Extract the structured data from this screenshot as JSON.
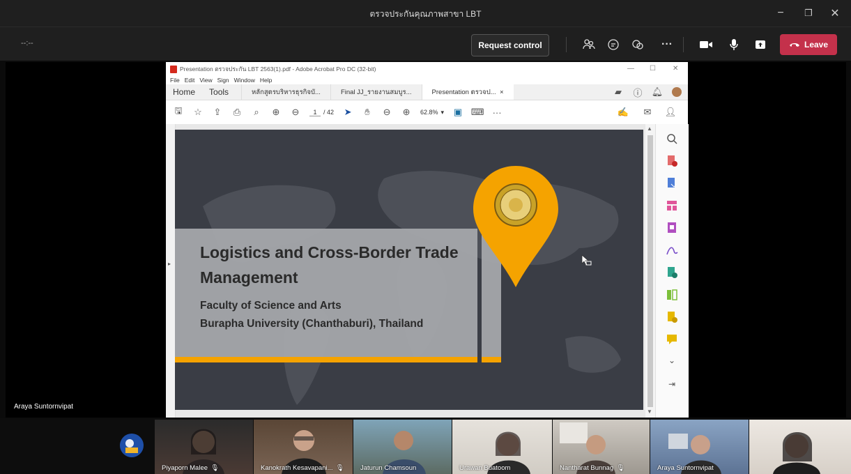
{
  "window": {
    "title": "ตรวจประกันคุณภาพสาขา LBT",
    "minimize": "−",
    "maximize": "❐",
    "close": "✕"
  },
  "meeting": {
    "timer": "--:--",
    "request_control": "Request control",
    "leave_label": "Leave",
    "leave_color": "#c4314b"
  },
  "presenter": {
    "name": "Araya Suntornvipat"
  },
  "acrobat": {
    "title": "Presentation ตรวจประกัน LBT 2563(1).pdf - Adobe Acrobat Pro DC (32-bit)",
    "menu": [
      "File",
      "Edit",
      "View",
      "Sign",
      "Window",
      "Help"
    ],
    "nav": [
      "Home",
      "Tools"
    ],
    "tabs": [
      {
        "label": "หลักสูตรบริหารธุรกิจบั..."
      },
      {
        "label": "Final JJ_รายงานสมบูร..."
      },
      {
        "label": "Presentation ตรวจป...",
        "close": "×"
      }
    ],
    "page_current": "1",
    "page_total": "/ 42",
    "zoom": "62.8%",
    "more": "···"
  },
  "slide": {
    "title_line1": "Logistics and Cross-Border Trade",
    "title_line2": "Management",
    "sub_line1": "Faculty of Science and Arts",
    "sub_line2": "Burapha University (Chanthaburi), Thailand",
    "accent_color": "#f5a300",
    "bg_color": "#3a3d45"
  },
  "participants": [
    {
      "name": "Piyaporn Malee",
      "muted": true
    },
    {
      "name": "Kanokrath Kesavapani...",
      "muted": true
    },
    {
      "name": "Jaturun Chamsoun",
      "muted": false
    },
    {
      "name": "Urawan Buatoom",
      "muted": false
    },
    {
      "name": "Nantharat Bunnag",
      "muted": true
    },
    {
      "name": "Araya Suntornvipat",
      "muted": false
    },
    {
      "name": "",
      "muted": false
    }
  ]
}
